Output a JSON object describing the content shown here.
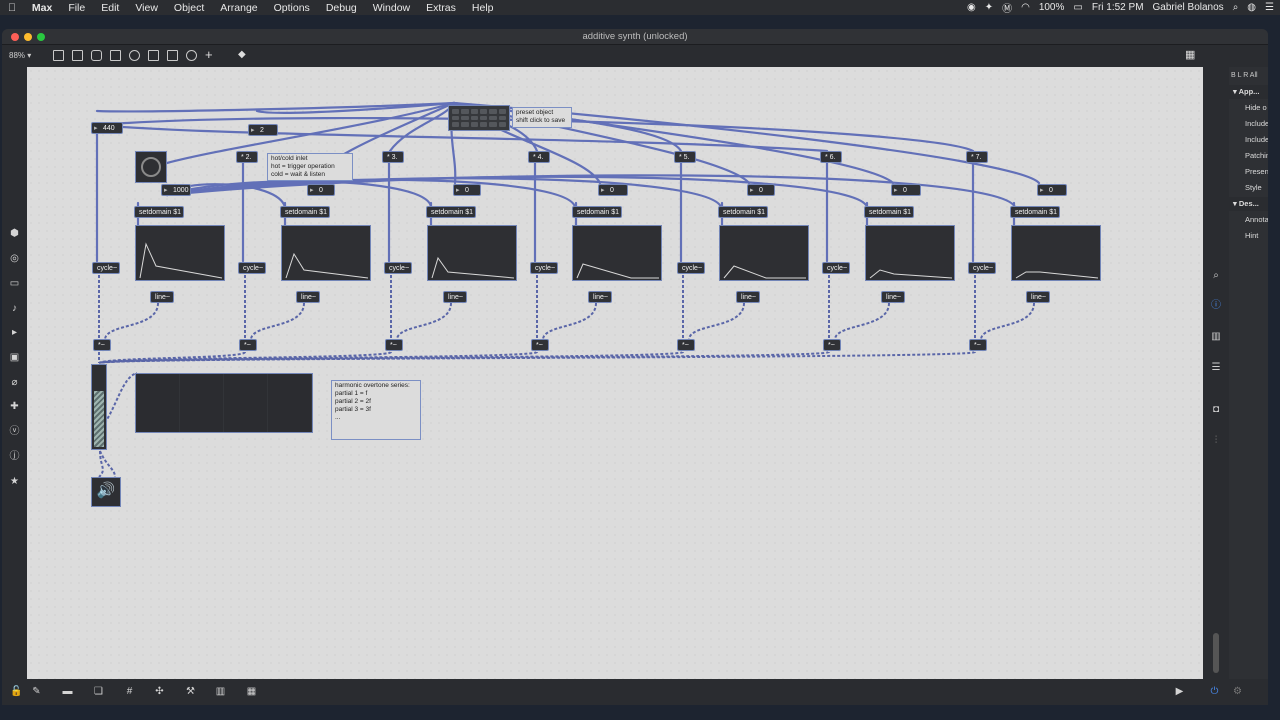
{
  "menubar": {
    "app": "Max",
    "items": [
      "File",
      "Edit",
      "View",
      "Object",
      "Arrange",
      "Options",
      "Debug",
      "Window",
      "Extras",
      "Help"
    ],
    "battery": "100%",
    "clock": "Fri 1:52 PM",
    "user": "Gabriel Bolanos"
  },
  "window": {
    "title": "additive synth (unlocked)",
    "zoom": "88%"
  },
  "patch": {
    "freq_number": "440",
    "partials_number": "2",
    "time_number": "1000",
    "multipliers": [
      "* 2.",
      "* 3.",
      "* 4.",
      "* 5.",
      "* 6.",
      "* 7."
    ],
    "amp_numbers": [
      "0",
      "0",
      "0",
      "0",
      "0",
      "0",
      "0"
    ],
    "setdomain_label": "setdomain $1",
    "cycle_label": "cycle~",
    "line_label": "line~",
    "mult_label": "*~",
    "preset_comment": "preset object\nshift click to save",
    "hotcold_comment": "hot/cold inlet\nhot = trigger operation\ncold = wait & listen",
    "series_comment": "harmonic overtone series:\npartial 1 = f\npartial 2 = 2f\npartial 3 = 3f\n..."
  },
  "inspector": {
    "tabs": "B L R All",
    "section1": "App...",
    "rows1": [
      "Hide o",
      "Include",
      "Include",
      "Patchin",
      "Present",
      "Style"
    ],
    "section2": "Des...",
    "rows2": [
      "Annota",
      "Hint"
    ]
  },
  "icons": {
    "left": [
      "cube-icon",
      "circle-icon",
      "window-icon",
      "music-note-icon",
      "play-list-icon",
      "image-icon",
      "paperclip-icon",
      "puzzle-icon",
      "v-icon",
      "j-icon",
      "star-icon"
    ],
    "right": [
      "search-icon",
      "info-icon",
      "book-icon",
      "list-icon",
      "camera-icon",
      "sliders-icon"
    ],
    "bottom": [
      "lock-icon",
      "edit-icon",
      "presentation-icon",
      "layers-icon",
      "grid-icon",
      "snap-icon",
      "wrench-icon",
      "piano-icon",
      "keyboard-icon"
    ]
  }
}
